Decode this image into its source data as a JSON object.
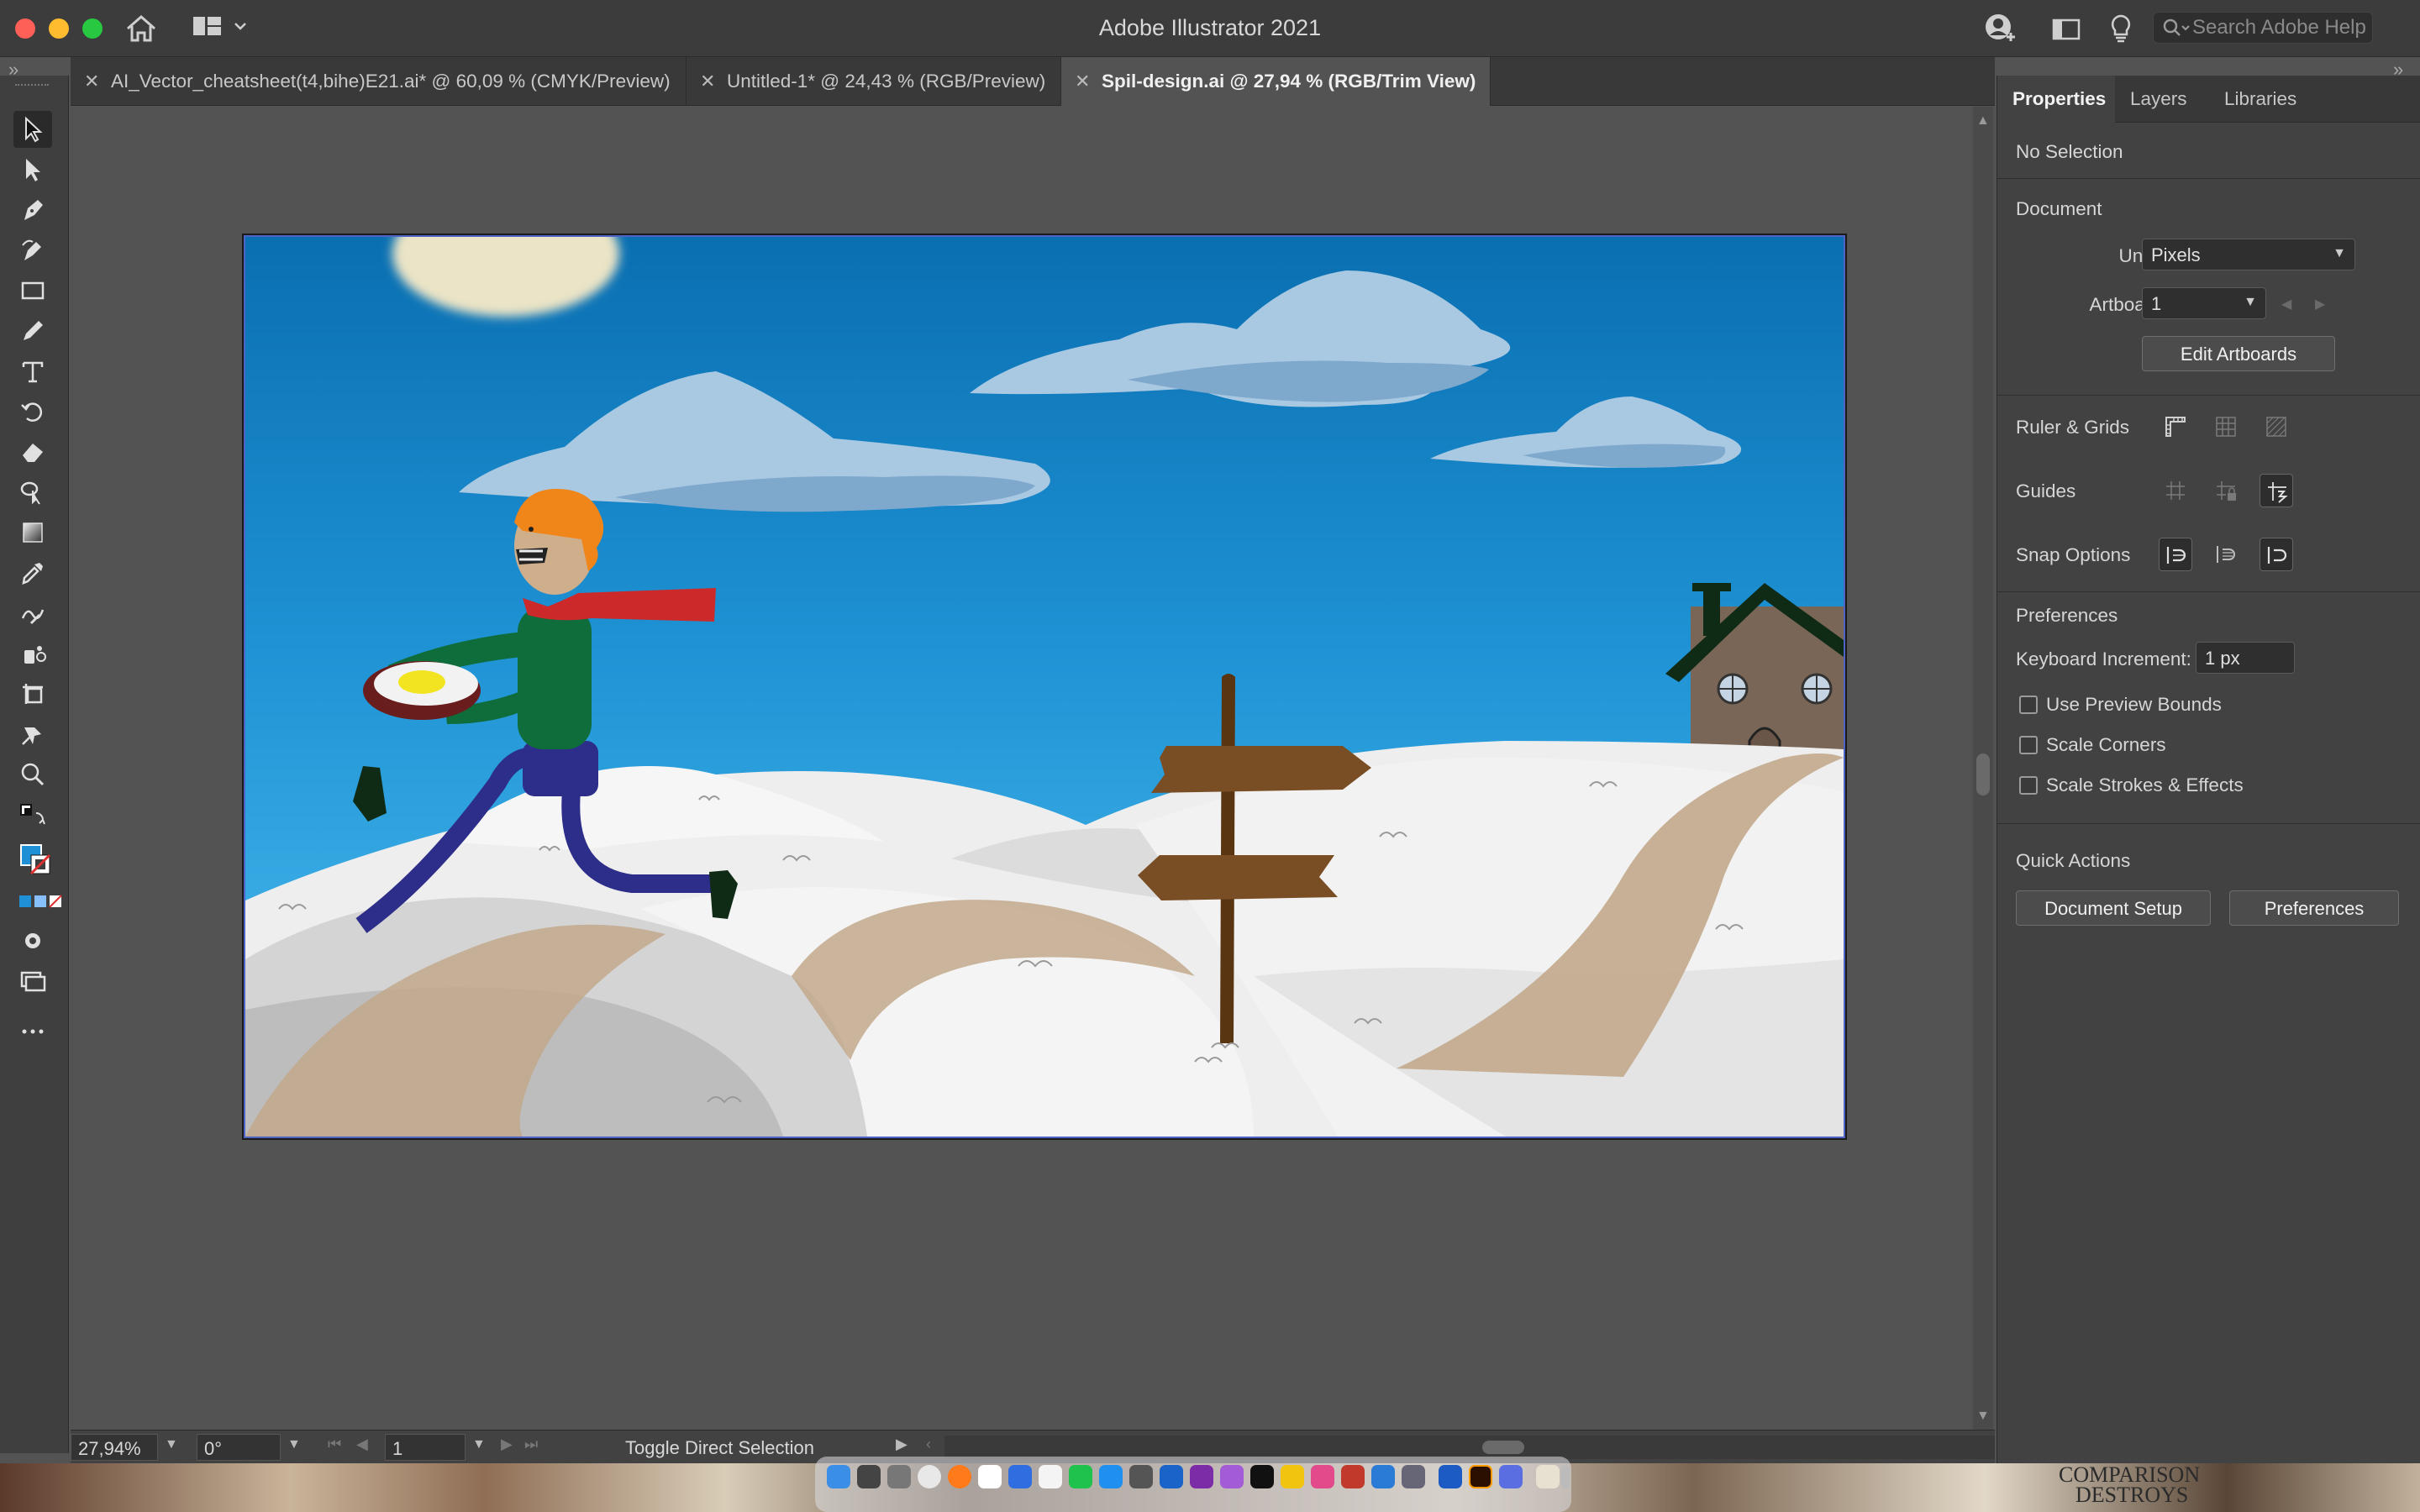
{
  "app": {
    "title": "Adobe Illustrator 2021",
    "search_placeholder": "Search Adobe Help"
  },
  "tabs": [
    {
      "label": "AI_Vector_cheatsheet(t4,bihe)E21.ai* @ 60,09 % (CMYK/Preview)",
      "active": false
    },
    {
      "label": "Untitled-1* @ 24,43 % (RGB/Preview)",
      "active": false
    },
    {
      "label": "Spil-design.ai @ 27,94 % (RGB/Trim View)",
      "active": true
    }
  ],
  "tools": [
    "selection-tool-icon",
    "direct-selection-tool-icon",
    "pen-tool-icon",
    "curvature-tool-icon",
    "rectangle-tool-icon",
    "pencil-tool-icon",
    "type-tool-icon",
    "rotate-tool-icon",
    "eraser-tool-icon",
    "shape-builder-tool-icon",
    "gradient-tool-icon",
    "eyedropper-tool-icon",
    "width-tool-icon",
    "symbol-sprayer-tool-icon",
    "artboard-tool-icon",
    "puppet-warp-tool-icon",
    "zoom-tool-icon"
  ],
  "colors": {
    "fill": "#1f8fd6",
    "stroke": "#ffffff",
    "accent": "#4f63c7"
  },
  "status": {
    "zoom": "27,94%",
    "rotation": "0°",
    "artboard": "1",
    "message": "Toggle Direct Selection"
  },
  "properties": {
    "tabs": [
      "Properties",
      "Layers",
      "Libraries"
    ],
    "selection": "No Selection",
    "document_heading": "Document",
    "units_label": "Units:",
    "units_value": "Pixels",
    "artboard_label": "Artboard:",
    "artboard_value": "1",
    "edit_artboards": "Edit Artboards",
    "ruler_grids": "Ruler & Grids",
    "guides": "Guides",
    "snap_options": "Snap Options",
    "preferences_heading": "Preferences",
    "keyboard_increment_label": "Keyboard Increment:",
    "keyboard_increment_value": "1 px",
    "checkboxes": [
      "Use Preview Bounds",
      "Scale Corners",
      "Scale Strokes & Effects"
    ],
    "quick_actions": "Quick Actions",
    "document_setup": "Document Setup",
    "preferences_button": "Preferences"
  },
  "dock": {
    "posters": [
      "COMPARISON",
      "DESTROYS"
    ]
  }
}
